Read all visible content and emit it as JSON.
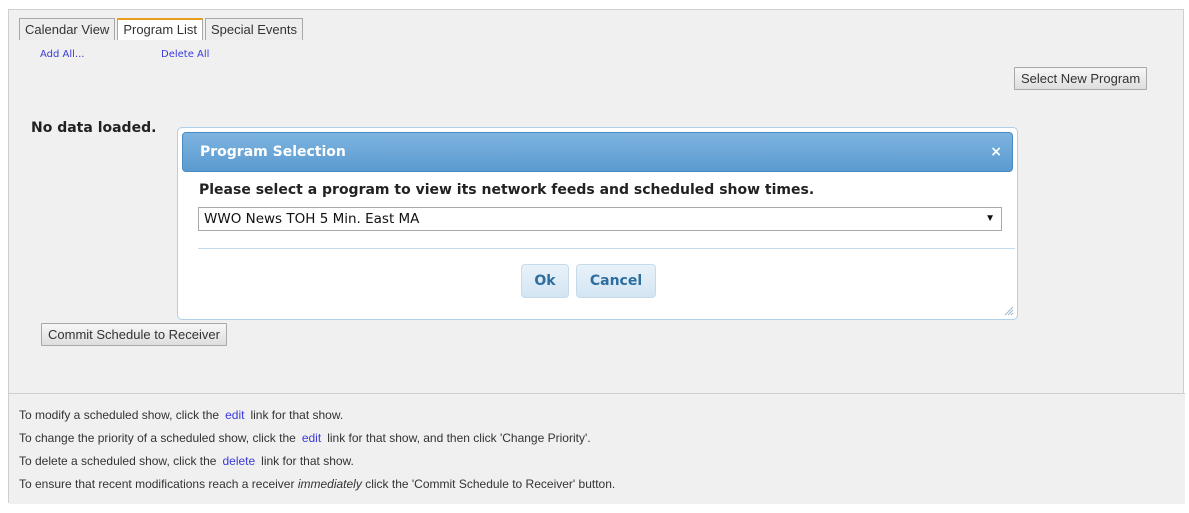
{
  "tabs": [
    {
      "label": "Calendar View",
      "active": false
    },
    {
      "label": "Program List",
      "active": true
    },
    {
      "label": "Special Events",
      "active": false
    }
  ],
  "actions": {
    "add_all": "Add All...",
    "delete_all": "Delete All",
    "select_new_program": "Select New Program",
    "commit_schedule": "Commit Schedule to Receiver"
  },
  "status": {
    "no_data": "No data loaded."
  },
  "dialog": {
    "title": "Program Selection",
    "close_glyph": "×",
    "prompt": "Please select a program to view its network feeds and scheduled show times.",
    "selected_program": "WWO News TOH 5 Min. East MA",
    "select_arrow": "▼",
    "ok_label": "Ok",
    "cancel_label": "Cancel"
  },
  "help": {
    "line1": {
      "before": "To modify a scheduled show, click the",
      "link": "edit",
      "after": "link for that show."
    },
    "line2": {
      "before": "To change the priority of a scheduled show, click the",
      "link": "edit",
      "after": "link for that show, and then click 'Change Priority'."
    },
    "line3": {
      "before": "To delete a scheduled show, click the",
      "link": "delete",
      "after": "link for that show."
    },
    "line4": {
      "before": "To ensure that recent modifications reach a receiver",
      "emphasis": "immediately",
      "after": "click the 'Commit Schedule to Receiver' button."
    }
  },
  "colors": {
    "active_tab_accent": "#e89e1b",
    "link": "#3a3adb",
    "dialog_title_bg": "#5b9ad0",
    "dialog_button_text": "#2e6e9e"
  }
}
